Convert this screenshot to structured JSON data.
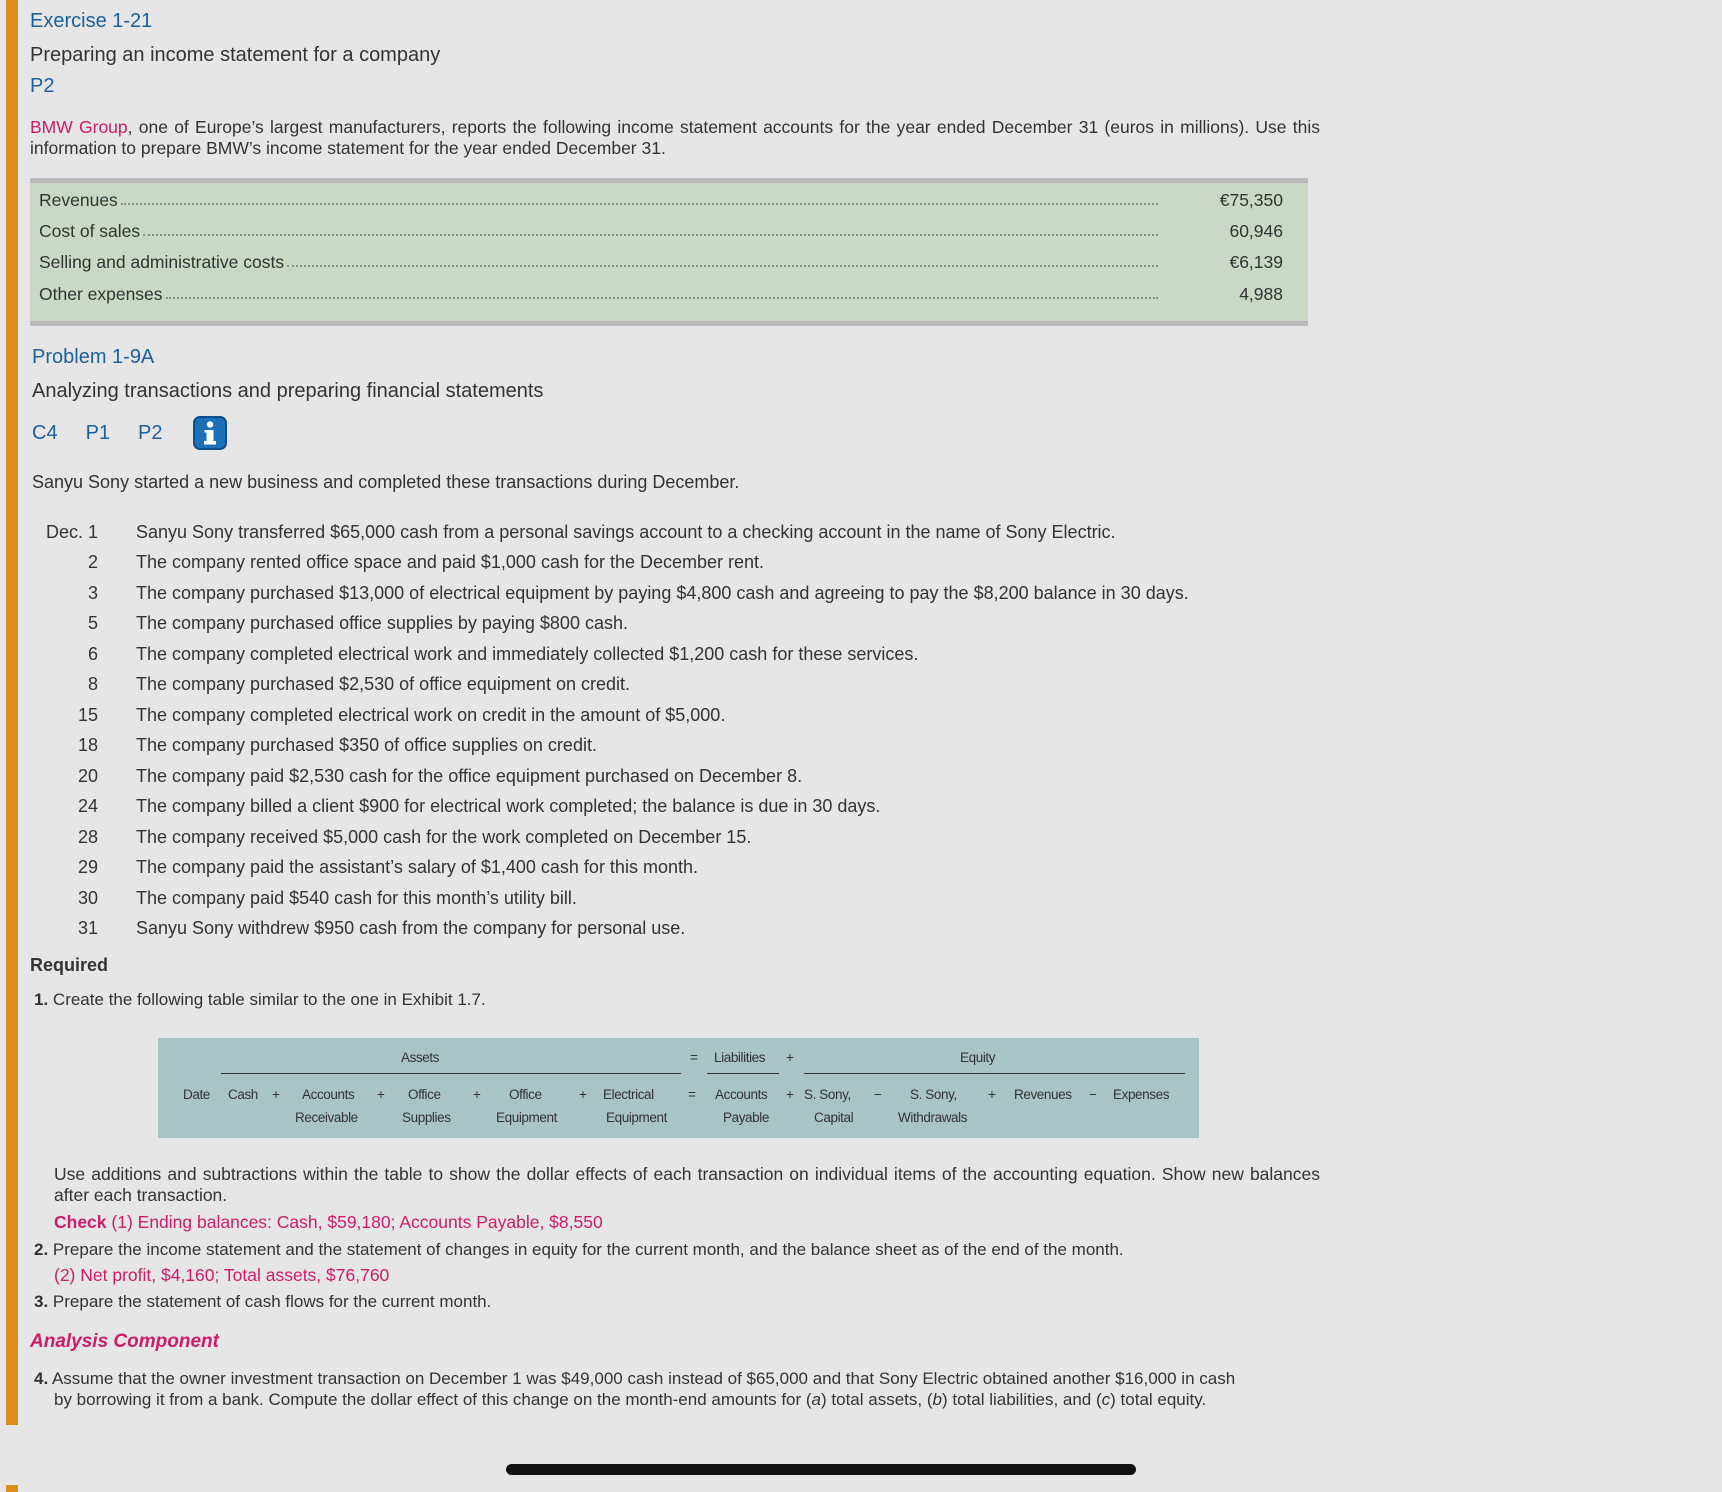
{
  "exercise": {
    "title": "Exercise 1-21",
    "subtitle": "Preparing an income statement for a company",
    "code": "P2",
    "intro_link": "BMW Group",
    "intro_text": ", one of Europe’s largest manufacturers, reports the following income statement accounts for the year ended December 31 (euros in millions). Use this information to prepare BMW’s income statement for the year ended December 31.",
    "accounts": [
      {
        "label": "Revenues",
        "value": "€75,350"
      },
      {
        "label": "Cost of sales",
        "value": "60,946"
      },
      {
        "label": "Selling and administrative costs",
        "value": "€6,139"
      },
      {
        "label": "Other expenses",
        "value": "4,988"
      }
    ]
  },
  "problem": {
    "title": "Problem 1-9A",
    "subtitle": "Analyzing transactions and preparing financial statements",
    "codes": [
      "C4",
      "P1",
      "P2"
    ],
    "intro": "Sanyu Sony started a new business and completed these transactions during December.",
    "transactions": [
      {
        "date": "Dec. 1",
        "text": "Sanyu Sony transferred $65,000 cash from a personal savings account to a checking account in the name of Sony Electric."
      },
      {
        "date": "2",
        "text": "The company rented office space and paid $1,000 cash for the December rent."
      },
      {
        "date": "3",
        "text": "The company purchased $13,000 of electrical equipment by paying $4,800 cash and agreeing to pay the $8,200 balance in 30 days."
      },
      {
        "date": "5",
        "text": "The company purchased office supplies by paying $800 cash."
      },
      {
        "date": "6",
        "text": "The company completed electrical work and immediately collected $1,200 cash for these services."
      },
      {
        "date": "8",
        "text": "The company purchased $2,530 of office equipment on credit."
      },
      {
        "date": "15",
        "text": "The company completed electrical work on credit in the amount of $5,000."
      },
      {
        "date": "18",
        "text": "The company purchased $350 of office supplies on credit."
      },
      {
        "date": "20",
        "text": "The company paid $2,530 cash for the office equipment purchased on December 8."
      },
      {
        "date": "24",
        "text": "The company billed a client $900 for electrical work completed; the balance is due in 30 days."
      },
      {
        "date": "28",
        "text": "The company received $5,000 cash for the work completed on December 15."
      },
      {
        "date": "29",
        "text": "The company paid the assistant’s salary of $1,400 cash for this month."
      },
      {
        "date": "30",
        "text": "The company paid $540 cash for this month’s utility bill."
      },
      {
        "date": "31",
        "text": "Sanyu Sony withdrew $950 cash from the company for personal use."
      }
    ],
    "required_heading": "Required",
    "req1_num": "1.",
    "req1_text": " Create the following table similar to the one in Exhibit 1.7.",
    "table": {
      "assets_header": "Assets",
      "eq1": "=",
      "liabilities_header": "Liabilities",
      "plus_top": "+",
      "equity_header": "Equity",
      "date": "Date",
      "cash": "Cash",
      "plus": "+",
      "minus": "−",
      "ar1": "Accounts",
      "ar2": "Receivable",
      "os1": "Office",
      "os2": "Supplies",
      "oe1": "Office",
      "oe2": "Equipment",
      "ee1": "Electrical",
      "ee2": "Equipment",
      "ap1": "Accounts",
      "ap2": "Payable",
      "sc1": "S. Sony,",
      "sc2": "Capital",
      "sw1": "S. Sony,",
      "sw2": "Withdrawals",
      "revenues": "Revenues",
      "expenses": "Expenses"
    },
    "use_text": "Use additions and subtractions within the table to show the dollar effects of each transaction on individual items of the accounting equation. Show new balances after each transaction.",
    "check1_bold": "Check",
    "check1_text": " (1) Ending balances: Cash, $59,180; Accounts Payable, $8,550",
    "req2_num": "2.",
    "req2_text": " Prepare the income statement and the statement of changes in equity for the current month, and the balance sheet as of the end of the month.",
    "check2": "(2) Net profit, $4,160; Total assets, $76,760",
    "req3_num": "3.",
    "req3_text": " Prepare the statement of cash flows for the current month.",
    "analysis_heading": "Analysis Component",
    "req4_num": "4.",
    "req4_line1": " Assume that the owner investment transaction on December 1 was $49,000 cash instead of $65,000 and that Sony Electric obtained another $16,000 in cash",
    "req4_line2_a": "by borrowing it from a bank. Compute the dollar effect of this change on the month-end amounts for (",
    "a": "a",
    "req4_line2_b": ") total assets, (",
    "b": "b",
    "req4_line2_c": ") total liabilities, and (",
    "c": "c",
    "req4_line2_d": ") total equity."
  },
  "colors": {
    "accent": "#d98e1e",
    "heading_blue": "#1b5fa0",
    "check_pink": "#cf1b6a",
    "accounts_bg": "#c9d9c5",
    "table_bg": "#a8c4c4"
  },
  "icons": [
    "info-icon"
  ]
}
